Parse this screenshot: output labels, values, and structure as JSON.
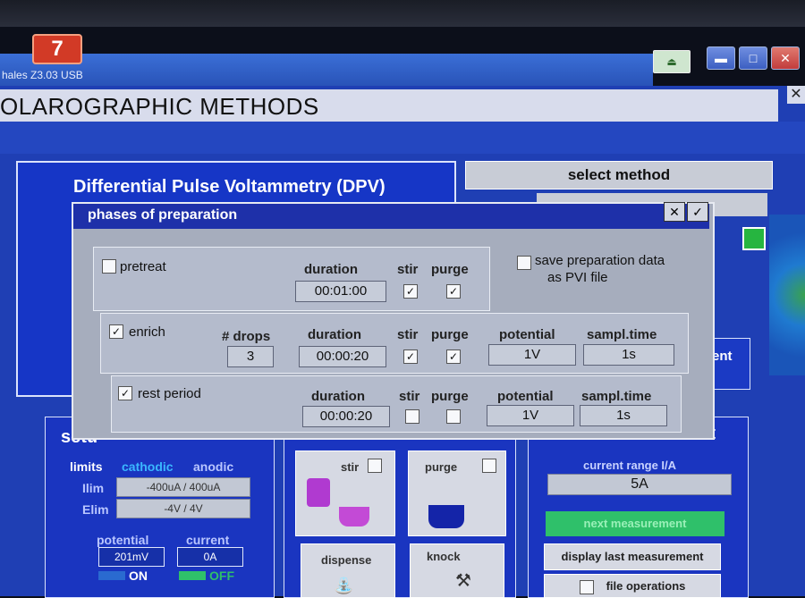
{
  "window": {
    "title": "hales Z3.03 USB",
    "header": "OLAROGRAPHIC METHODS",
    "app_icon_glyph": "7",
    "controls": {
      "minimize": "▬",
      "maximize": "□",
      "close": "✕"
    },
    "tray_icon": "drive-icon"
  },
  "method_panel": {
    "title": "Differential Pulse Voltammetry (DPV)",
    "select_label": "select method",
    "right_label": "ent"
  },
  "dialog": {
    "title": "phases of preparation",
    "close_glyph": "✕",
    "ok_glyph": "✓",
    "save_option": {
      "checked": false,
      "line1": "save preparation data",
      "line2": "as PVI file"
    },
    "headers": {
      "drops": "# drops",
      "duration": "duration",
      "stir": "stir",
      "purge": "purge",
      "potential": "potential",
      "sampl_time": "sampl.time"
    },
    "pretreat": {
      "label": "pretreat",
      "checked": false,
      "duration": "00:01:00",
      "stir": true,
      "purge": true
    },
    "enrich": {
      "label": "enrich",
      "checked": true,
      "drops": "3",
      "duration": "00:00:20",
      "stir": true,
      "purge": true,
      "potential": "1V",
      "sampl_time": "1s"
    },
    "rest": {
      "label": "rest period",
      "checked": true,
      "duration": "00:00:20",
      "stir": false,
      "purge": false,
      "potential": "1V",
      "sampl_time": "1s"
    }
  },
  "setup": {
    "title": "setu",
    "limits": "limits",
    "cathodic": "cathodic",
    "anodic": "anodic",
    "ilim_label": "Ilim",
    "ilim_value": "-400uA /  400uA",
    "elim_label": "Elim",
    "elim_value": "-4V /  4V",
    "potential_label": "potential",
    "current_label": "current",
    "potential_value": "201mV",
    "current_value": "0A",
    "on_label": "ON",
    "off_label": "OFF"
  },
  "tiles": {
    "stir": "stir",
    "purge": "purge",
    "dispense": "dispense",
    "knock": "knock"
  },
  "measurement": {
    "title": "ent",
    "current_range_label": "current range I/A",
    "current_range_value": "5A",
    "next_measurement": "next measurement",
    "display_last": "display last measurement",
    "file_operations": "file operations"
  },
  "colors": {
    "primary_blue": "#1f3fb4",
    "dialog_bg": "#a6adbd",
    "accent_cyan": "#3ab7ff",
    "green": "#2fc06a"
  }
}
